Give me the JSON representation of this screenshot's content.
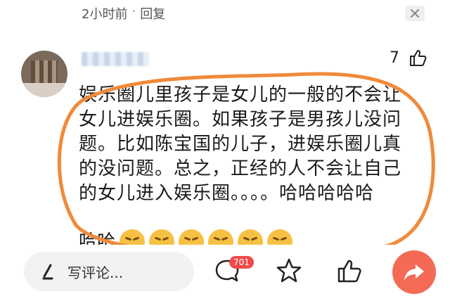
{
  "meta": {
    "time_ago": "2小时前",
    "separator": "·",
    "reply_label": "回复"
  },
  "comment": {
    "like_count": "7",
    "lines": [
      "娱乐圈儿里孩子是女儿的一般的不会让",
      "女儿进娱乐圈。如果孩子是男孩儿没问",
      "题。比如陈宝国的儿子，进娱乐圈儿真",
      "的没问题。总之，正经的人不会让自己",
      "的女儿进入娱乐圈。。。。哈哈哈哈哈"
    ],
    "tail_text": "哈哈",
    "emoji_icon": "laughing-squint-face",
    "emoji_count": 6
  },
  "toolbar": {
    "write_placeholder": "写评论...",
    "comment_badge": "701",
    "icons": [
      "pen-icon",
      "comment-bubble-icon",
      "star-icon",
      "thumbs-up-icon",
      "share-arrow-icon"
    ]
  },
  "colors": {
    "highlight_oval": "#f08a3a",
    "badge_bg": "#f04b4b",
    "share_bg": "#f46a55",
    "emoji_face": "#f6c143"
  }
}
